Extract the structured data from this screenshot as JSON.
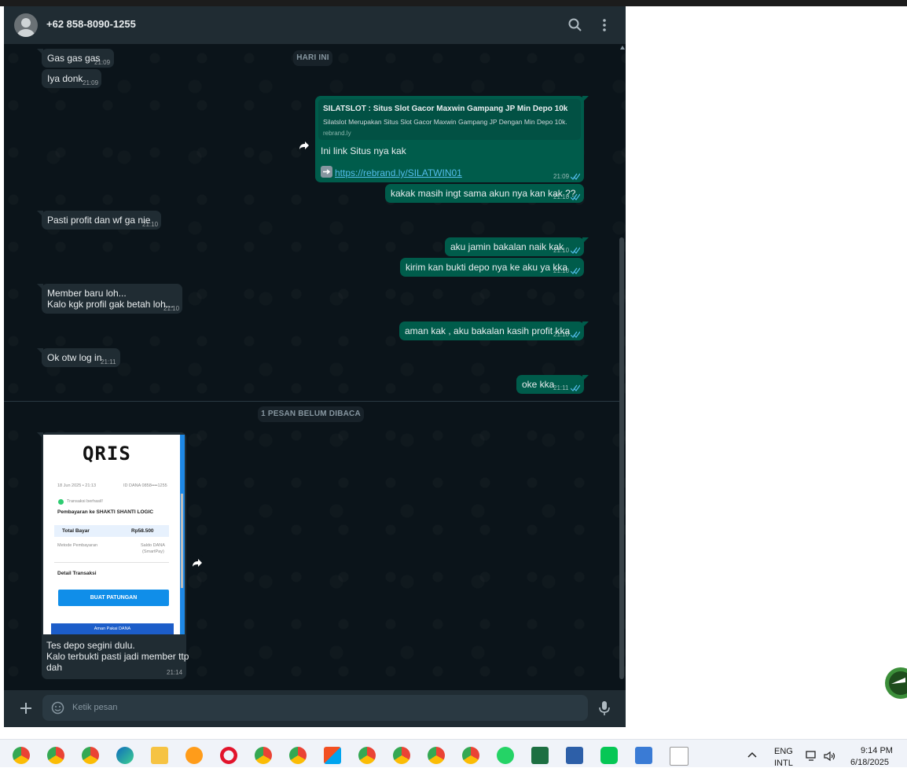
{
  "header": {
    "contact": "+62 858-8090-1255",
    "search_icon": "search-icon",
    "menu_icon": "menu-icon"
  },
  "chat": {
    "date_divider": "HARI INI",
    "unread_divider": "1 PESAN BELUM DIBACA",
    "messages": [
      {
        "text": "Gas gas gas",
        "time": "21:09"
      },
      {
        "text": "Iya donk",
        "time": "21:09"
      },
      {
        "preview_title": "SILATSLOT : Situs Slot Gacor Maxwin Gampang JP Min Depo 10k",
        "preview_desc": "Silatslot Merupakan Situs Slot Gacor Maxwin Gampang JP Dengan Min Depo 10k.",
        "preview_domain": "rebrand.ly",
        "text": "Ini link Situs nya kak",
        "link": "https://rebrand.ly/SILATWIN01",
        "time": "21:09"
      },
      {
        "text": "kakak masih ingt sama akun nya kan kak ??",
        "time": "21:10"
      },
      {
        "text": "Pasti profit dan wf ga nie",
        "time": "21:10"
      },
      {
        "text": "aku jamin bakalan naik kak",
        "time": "21:10"
      },
      {
        "text": "kirim kan bukti depo nya ke aku ya kka",
        "time": "21:10"
      },
      {
        "line1": "Member baru loh...",
        "line2": "Kalo kgk profil gak betah loh...",
        "time": "21:10"
      },
      {
        "text": "aman kak , aku bakalan kasih profit kka",
        "time": "21:10"
      },
      {
        "text": "Ok otw log in",
        "time": "21:11"
      },
      {
        "text": "oke kka",
        "time": "21:11"
      },
      {
        "line1": "Tes depo segini dulu.",
        "line2": "Kalo terbukti pasti jadi member ttp",
        "line3": "dah",
        "time": "21:14"
      }
    ],
    "receipt": {
      "logo": "QRIS",
      "date": "18 Jun 2025 • 21:13",
      "id": "ID DANA 0858••••1255",
      "status": "Transaksi berhasil!",
      "merchant": "Pembayaran ke SHAKTI SHANTI LOGIC",
      "total_label": "Total Bayar",
      "total_value": "Rp58.500",
      "method_label": "Metode Pembayaran",
      "method_value1": "Saldo DANA",
      "method_value2": "(SmartPay)",
      "detail_label": "Detail Transaksi",
      "button": "BUAT PATUNGAN",
      "banner": "Aman Pakai DANA"
    }
  },
  "composer": {
    "placeholder": "Ketik pesan"
  },
  "taskbar": {
    "lang1": "ENG",
    "lang2": "INTL",
    "time": "9:14 PM",
    "date": "6/18/2025"
  },
  "colors": {
    "incoming": "#202c33",
    "outgoing": "#005c4b",
    "link": "#53bdeb",
    "background": "#0b141a"
  }
}
